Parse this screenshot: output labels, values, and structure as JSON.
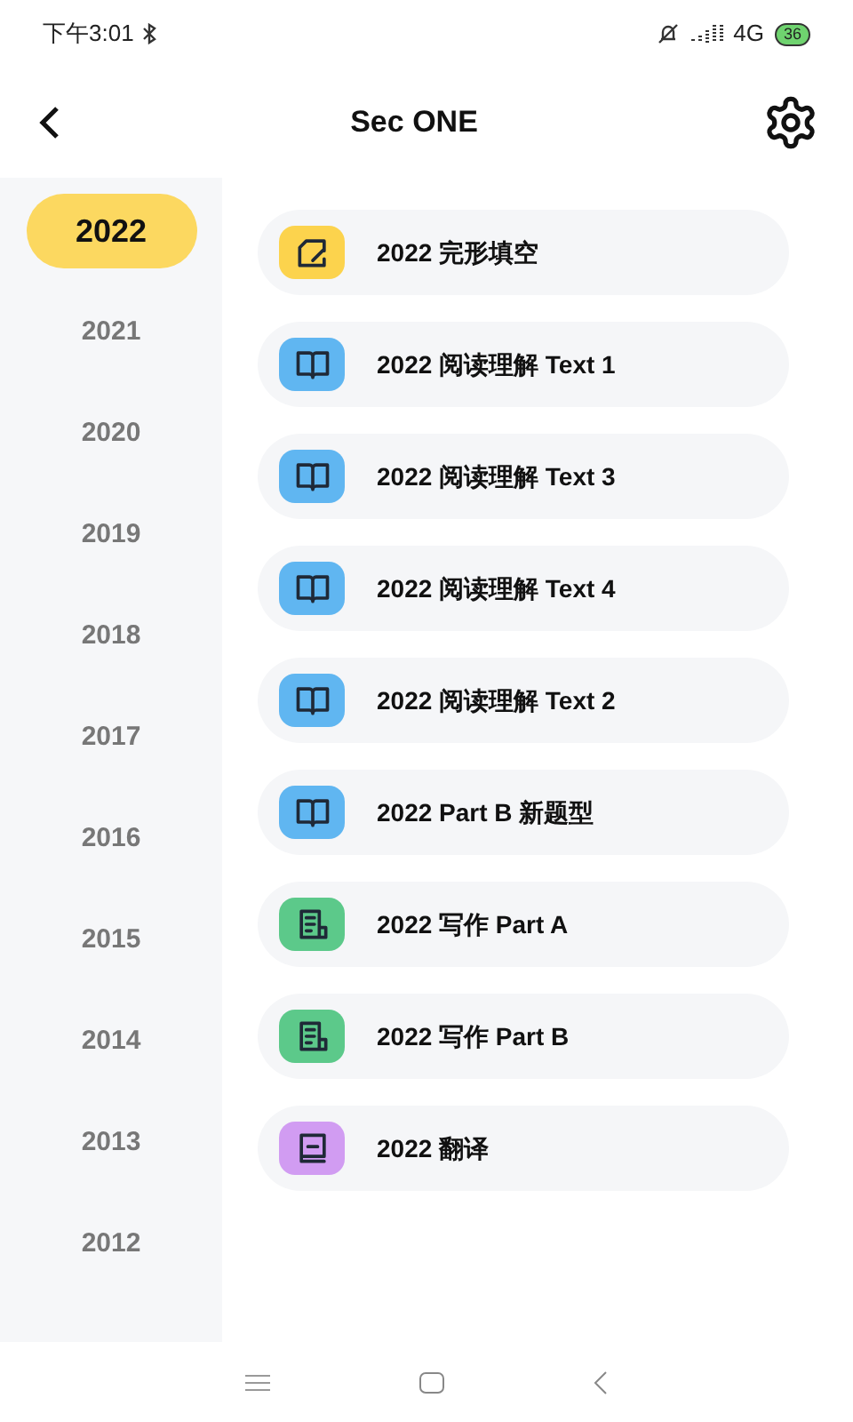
{
  "status_bar": {
    "time": "下午3:01",
    "network": "4G",
    "battery": "36"
  },
  "header": {
    "title": "Sec ONE"
  },
  "years": [
    {
      "label": "2022",
      "selected": true
    },
    {
      "label": "2021",
      "selected": false
    },
    {
      "label": "2020",
      "selected": false
    },
    {
      "label": "2019",
      "selected": false
    },
    {
      "label": "2018",
      "selected": false
    },
    {
      "label": "2017",
      "selected": false
    },
    {
      "label": "2016",
      "selected": false
    },
    {
      "label": "2015",
      "selected": false
    },
    {
      "label": "2014",
      "selected": false
    },
    {
      "label": "2013",
      "selected": false
    },
    {
      "label": "2012",
      "selected": false
    }
  ],
  "items": [
    {
      "label": "2022 完形填空",
      "kind": "cloze",
      "color": "#fcd34d"
    },
    {
      "label": "2022 阅读理解 Text 1",
      "kind": "reading",
      "color": "#60b6f1"
    },
    {
      "label": "2022 阅读理解 Text 3",
      "kind": "reading",
      "color": "#60b6f1"
    },
    {
      "label": "2022 阅读理解 Text 4",
      "kind": "reading",
      "color": "#60b6f1"
    },
    {
      "label": "2022 阅读理解 Text 2",
      "kind": "reading",
      "color": "#60b6f1"
    },
    {
      "label": "2022 Part B 新题型",
      "kind": "reading",
      "color": "#60b6f1"
    },
    {
      "label": "2022 写作 Part A",
      "kind": "writing",
      "color": "#5cc98a"
    },
    {
      "label": "2022 写作 Part B",
      "kind": "writing",
      "color": "#5cc98a"
    },
    {
      "label": "2022 翻译",
      "kind": "translation",
      "color": "#d19cf2"
    }
  ]
}
